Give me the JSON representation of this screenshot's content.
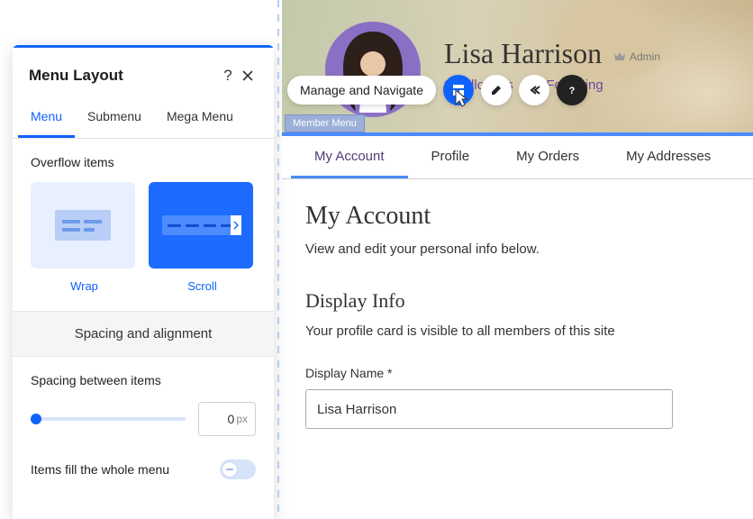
{
  "panel": {
    "title": "Menu Layout",
    "tabs": [
      {
        "label": "Menu",
        "active": true
      },
      {
        "label": "Submenu",
        "active": false
      },
      {
        "label": "Mega Menu",
        "active": false
      }
    ],
    "overflow": {
      "label": "Overflow items",
      "wrap": "Wrap",
      "scroll": "Scroll"
    },
    "subheader": "Spacing and alignment",
    "spacing": {
      "label": "Spacing between items",
      "value": "0",
      "unit": "px"
    },
    "fill": {
      "label": "Items fill the whole menu"
    }
  },
  "preview": {
    "user_name": "Lisa Harrison",
    "role": "Admin",
    "followers0": "0 Followers",
    "following0": "0 Following",
    "toolbar_label": "Manage and Navigate",
    "tag": "Member Menu",
    "menu": [
      "My Account",
      "Profile",
      "My Orders",
      "My Addresses"
    ],
    "content": {
      "h1": "My Account",
      "sub": "View and edit your personal info below.",
      "h2": "Display Info",
      "desc": "Your profile card is visible to all members of this site",
      "field_label": "Display Name *",
      "field_value": "Lisa Harrison"
    }
  }
}
